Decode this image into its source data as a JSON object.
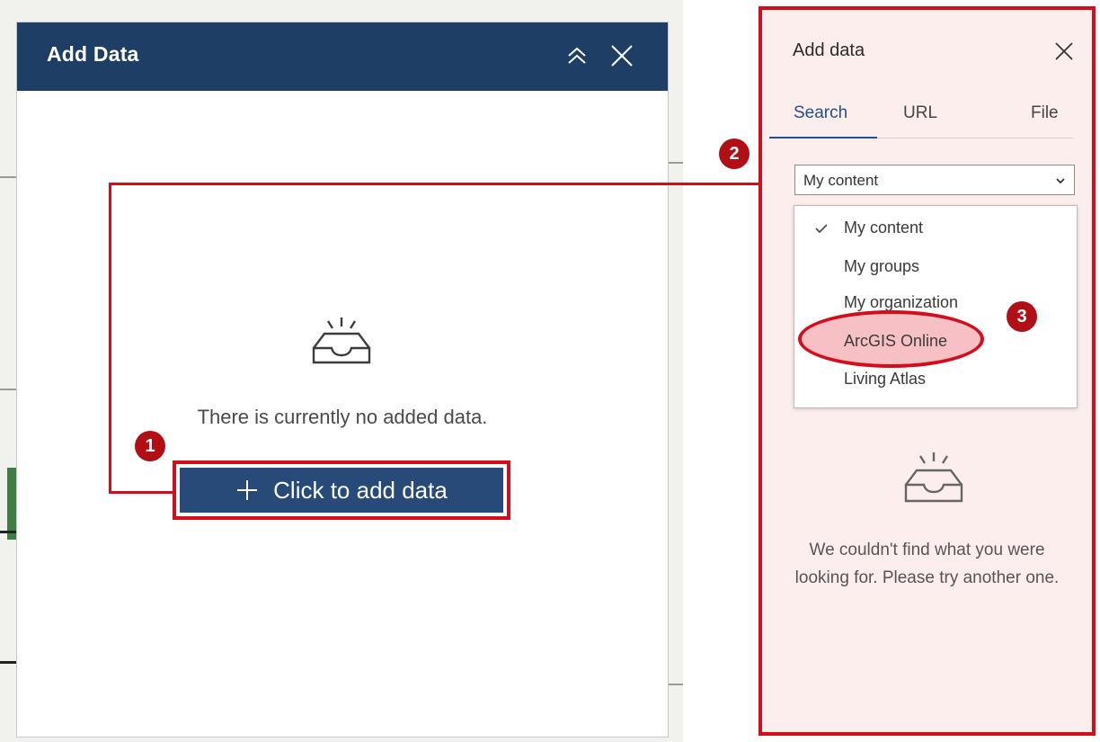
{
  "add_data_widget": {
    "title": "Add Data",
    "collapse_icon": "double-chevron-up-icon",
    "close_icon": "close-icon",
    "empty_message": "There is currently no added data.",
    "add_button_label": "Click to add data",
    "add_button_icon": "plus-icon"
  },
  "add_data_panel": {
    "title": "Add data",
    "close_icon": "close-icon",
    "tabs": [
      {
        "label": "Search",
        "active": true
      },
      {
        "label": "URL",
        "active": false
      },
      {
        "label": "File",
        "active": false
      }
    ],
    "source_select": {
      "value": "My content",
      "options": [
        "My content",
        "My groups",
        "My organization",
        "ArcGIS Online",
        "Living Atlas"
      ],
      "checked_option": "My content"
    },
    "empty_message": "We couldn't find what you were looking for. Please try another one."
  },
  "callouts": [
    {
      "number": "1"
    },
    {
      "number": "2"
    },
    {
      "number": "3"
    }
  ],
  "colors": {
    "header_bg": "#1f3e66",
    "button_bg": "#274a78",
    "callout_red": "#d40c1b",
    "badge_red": "#b20e16",
    "panel_tint": "#fdeeee"
  }
}
